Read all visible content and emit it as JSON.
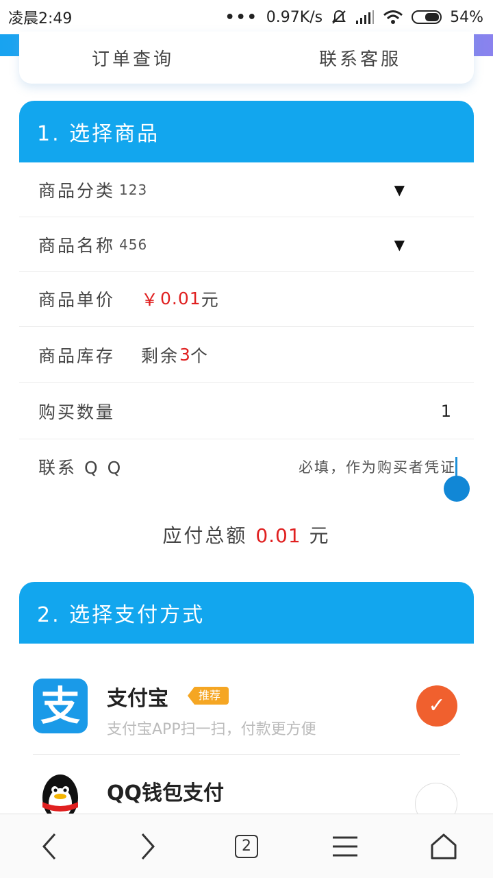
{
  "status_bar": {
    "time": "凌晨2:49",
    "network_speed": "0.97K/s",
    "battery": "54%"
  },
  "nav": {
    "order_query": "订单查询",
    "contact_service": "联系客服"
  },
  "section1": {
    "title": "1. 选择商品",
    "category_label": "商品分类",
    "category_value": "123",
    "name_label": "商品名称",
    "name_value": "456",
    "price_label": "商品单价",
    "price_symbol": "￥",
    "price_value": "0.01",
    "price_unit": "元",
    "stock_label": "商品库存",
    "stock_prefix": "剩余",
    "stock_value": "3",
    "stock_unit": "个",
    "quantity_label": "购买数量",
    "quantity_value": "1",
    "qq_label": "联系 Q Q",
    "qq_placeholder": "必填，作为购买者凭证"
  },
  "total": {
    "label": "应付总额",
    "value": "0.01",
    "unit": "元"
  },
  "section2": {
    "title": "2. 选择支付方式",
    "methods": [
      {
        "name": "支付宝",
        "badge": "推荐",
        "subtitle": "支付宝APP扫一扫，付款更方便",
        "selected": true,
        "logo_text": "支"
      },
      {
        "name": "QQ钱包支付",
        "selected": false
      }
    ]
  },
  "bottom_bar": {
    "tab_count": "2"
  },
  "colors": {
    "header_blue": "#12a6ee",
    "price_red": "#e02020",
    "check_orange": "#f0602e",
    "badge_orange": "#f5a623"
  }
}
